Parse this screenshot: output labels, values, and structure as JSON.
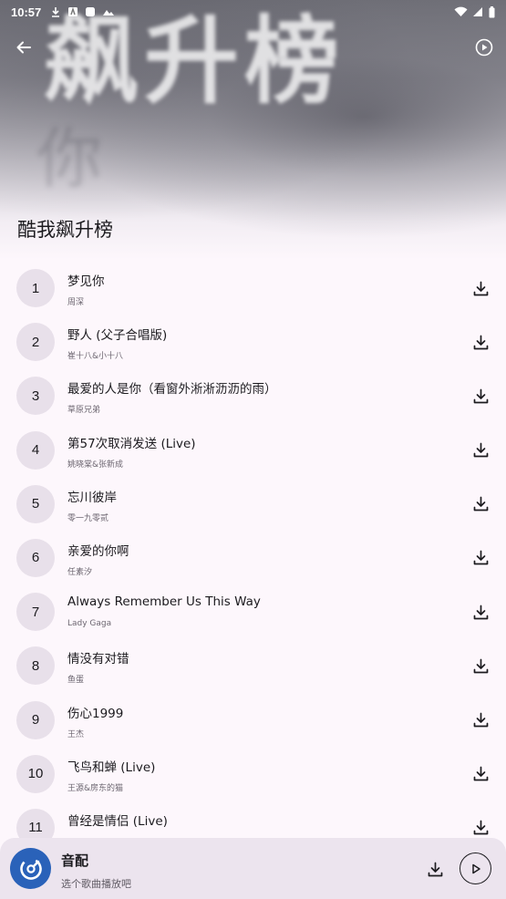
{
  "status_bar": {
    "time": "10:57"
  },
  "header": {
    "cover_text": "飙升榜",
    "cover_sub": "你"
  },
  "page_title": "酷我飙升榜",
  "songs": [
    {
      "rank": "1",
      "title": "梦见你",
      "artist": "周深"
    },
    {
      "rank": "2",
      "title": "野人 (父子合唱版)",
      "artist": "崔十八&小十八"
    },
    {
      "rank": "3",
      "title": "最爱的人是你（看窗外淅淅沥沥的雨）",
      "artist": "草原兄弟"
    },
    {
      "rank": "4",
      "title": "第57次取消发送 (Live)",
      "artist": "姚晓棠&张新成"
    },
    {
      "rank": "5",
      "title": "忘川彼岸",
      "artist": "零一九零贰"
    },
    {
      "rank": "6",
      "title": "亲爱的你啊",
      "artist": "任素汐"
    },
    {
      "rank": "7",
      "title": "Always Remember Us This Way",
      "artist": "Lady Gaga"
    },
    {
      "rank": "8",
      "title": "情没有对错",
      "artist": "鱼蛋"
    },
    {
      "rank": "9",
      "title": "伤心1999",
      "artist": "王杰"
    },
    {
      "rank": "10",
      "title": "飞鸟和蝉 (Live)",
      "artist": "王源&房东的猫"
    },
    {
      "rank": "11",
      "title": "曾经是情侣 (Live)",
      "artist": ""
    }
  ],
  "player": {
    "title": "音配",
    "subtitle": "选个歌曲播放吧"
  },
  "colors": {
    "accent": "#2a62b9",
    "rank_bg": "#e8e0ea",
    "player_bg": "#ece4ee",
    "page_bg": "#fdf7fc"
  },
  "icons": {
    "back": "arrow-left-icon",
    "play_top": "play-circle-icon",
    "download": "download-icon",
    "play": "play-icon",
    "app_logo": "music-disc-icon"
  }
}
